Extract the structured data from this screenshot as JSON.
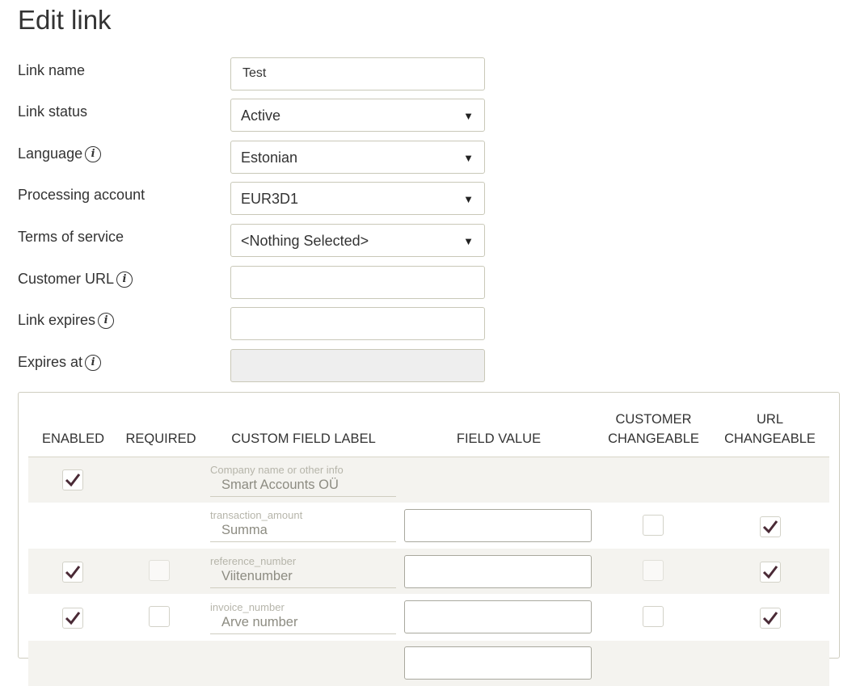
{
  "page": {
    "title": "Edit link"
  },
  "form": {
    "link_name": {
      "label": "Link name",
      "value": "Test"
    },
    "link_status": {
      "label": "Link status",
      "selected": "Active"
    },
    "language": {
      "label": "Language",
      "selected": "Estonian"
    },
    "processing_account": {
      "label": "Processing account",
      "selected": "EUR3D1"
    },
    "terms_of_service": {
      "label": "Terms of service",
      "selected": "<Nothing Selected>"
    },
    "customer_url": {
      "label": "Customer URL",
      "value": ""
    },
    "link_expires": {
      "label": "Link expires",
      "value": ""
    },
    "expires_at": {
      "label": "Expires at",
      "value": ""
    }
  },
  "icons": {
    "info": "i",
    "caret": "▼"
  },
  "table": {
    "headers": {
      "enabled": "ENABLED",
      "required": "REQUIRED",
      "custom_field_label": "CUSTOM FIELD LABEL",
      "field_value": "FIELD VALUE",
      "customer_changeable_1": "CUSTOMER",
      "customer_changeable_2": "CHANGEABLE",
      "url_changeable_1": "URL",
      "url_changeable_2": "CHANGEABLE"
    },
    "rows": [
      {
        "key": "Company name or other info",
        "label": "Smart Accounts OÜ",
        "enabled": true,
        "required": null,
        "customer_changeable": null,
        "url_changeable": null
      },
      {
        "key": "transaction_amount",
        "label": "Summa",
        "enabled": null,
        "required": null,
        "customer_changeable": false,
        "url_changeable": true
      },
      {
        "key": "reference_number",
        "label": "Viitenumber",
        "enabled": true,
        "required": false,
        "customer_changeable": false,
        "url_changeable": true
      },
      {
        "key": "invoice_number",
        "label": "Arve number",
        "enabled": true,
        "required": false,
        "customer_changeable": false,
        "url_changeable": true
      }
    ]
  },
  "colors": {
    "row_shade": "#f4f3ef",
    "border": "#c9c8b8",
    "check": "#4a2a36"
  }
}
